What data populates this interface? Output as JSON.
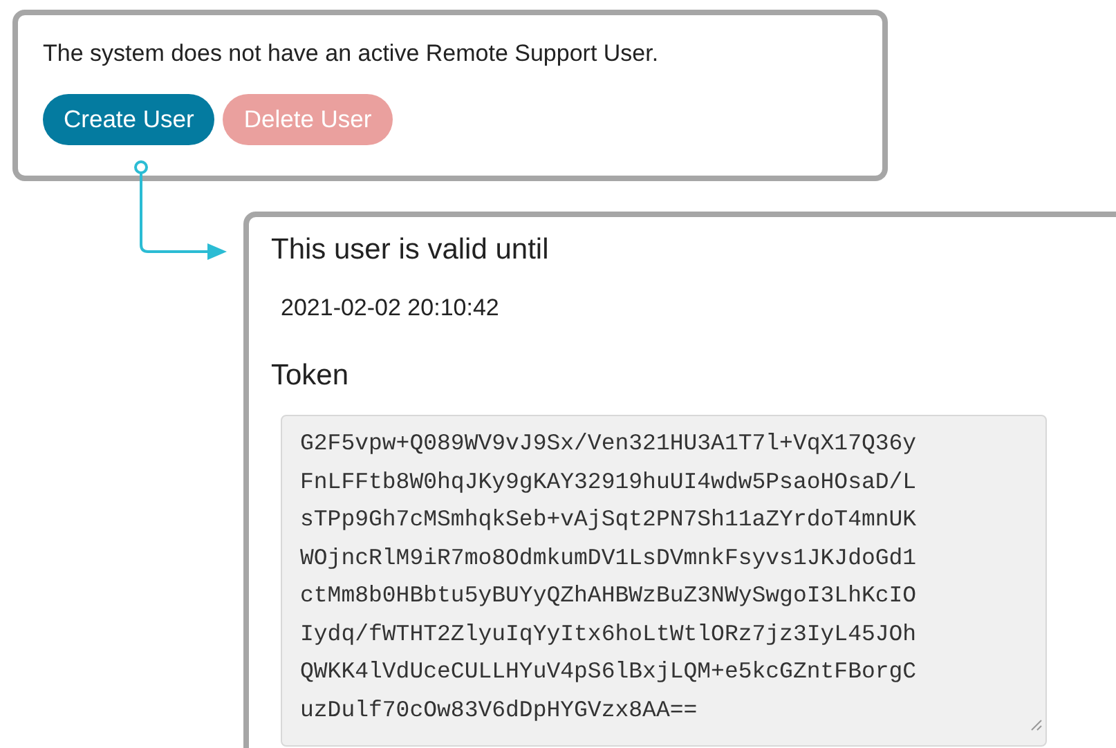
{
  "remote_support": {
    "message": "The system does not have an active Remote Support User.",
    "buttons": [
      {
        "label": "Create User",
        "kind": "primary",
        "disabled": false
      },
      {
        "label": "Delete User",
        "kind": "danger",
        "disabled": true
      }
    ]
  },
  "user_details": {
    "valid_until_label": "This user is valid until",
    "valid_until": "2021-02-02 20:10:42",
    "token_label": "Token",
    "token_lines": [
      "G2F5vpw+Q089WV9vJ9Sx/Ven321HU3A1T7l+VqX17Q36y",
      "FnLFFtb8W0hqJKy9gKAY32919huUI4wdw5PsaoHOsaD/L",
      "sTPp9Gh7cMSmhqkSeb+vAjSqt2PN7Sh11aZYrdoT4mnUK",
      "WOjncRlM9iR7mo8OdmkumDV1LsDVmnkFsyvs1JKJdoGd1",
      "ctMm8b0HBbtu5yBUYyQZhAHBWzBuZ3NWySwgoI3LhKcIO",
      "Iydq/fWTHT2ZlyuIqYyItx6hoLtWtlORz7jz3IyL45JOh",
      "QWKK4lVdUceCULLHYuV4pS6lBxjLQM+e5kcGZntFBorgC",
      "uzDulf70cOw83V6dDpHYGVzx8AA=="
    ]
  }
}
